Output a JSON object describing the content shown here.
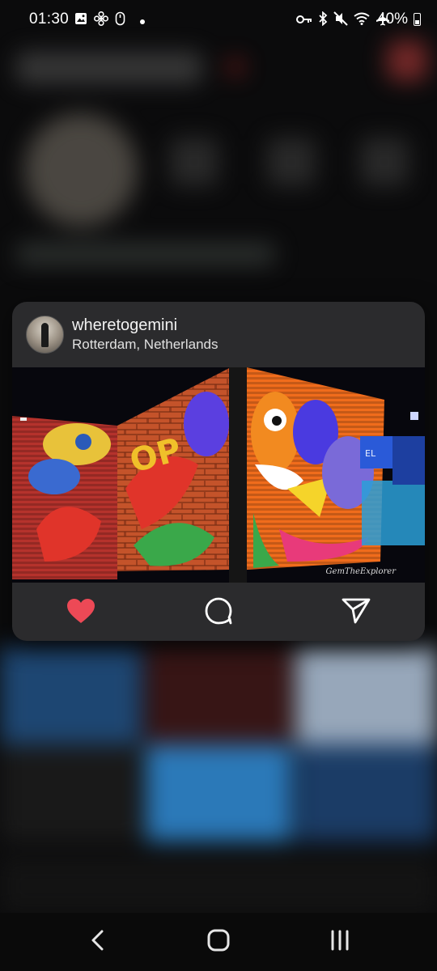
{
  "status_bar": {
    "time": "01:30",
    "battery": "40%",
    "left_icons": [
      "gallery-icon",
      "fan-icon",
      "mouse-icon",
      "dot-icon"
    ],
    "right_icons": [
      "key-icon",
      "bluetooth-icon",
      "mute-icon",
      "wifi-icon",
      "airplane-icon"
    ]
  },
  "preview": {
    "username": "wheretogemini",
    "location": "Rotterdam, Netherlands",
    "watermark": "GemTheExplorer",
    "actions": [
      "like-icon",
      "comment-icon",
      "share-icon"
    ],
    "like_color": "#ed4956"
  },
  "nav": {
    "buttons": [
      "back-icon",
      "home-icon",
      "recents-icon"
    ]
  }
}
